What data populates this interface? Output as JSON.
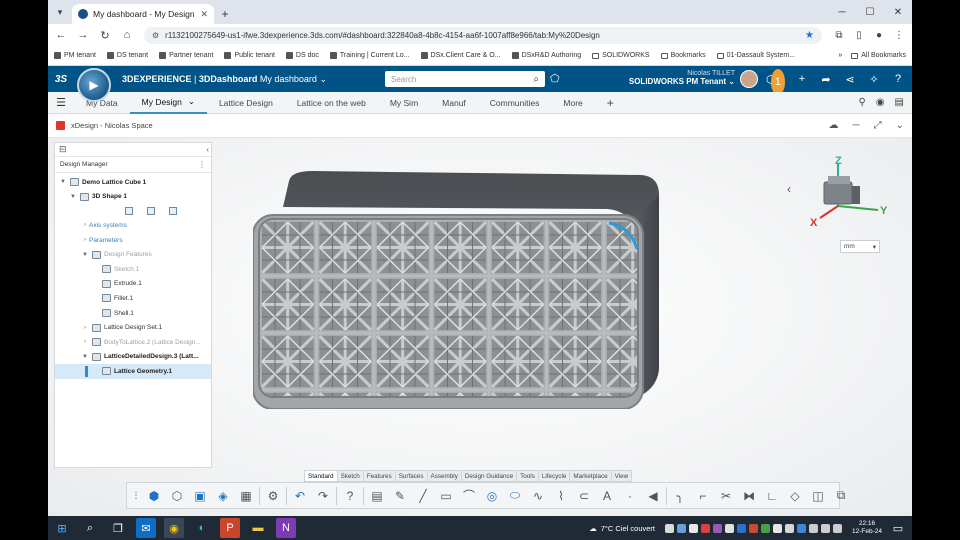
{
  "browser": {
    "tab_title": "My dashboard - My Design",
    "url": "r1132100275649-us1-ifwe.3dexperience.3ds.com/#dashboard:322840a8-4b8c-4154-aa6f-1007aff8e966/tab:My%20Design",
    "bookmarks": [
      "PM tenant",
      "DS tenant",
      "Partner tenant",
      "Public tenant",
      "DS doc",
      "Training | Current Lo...",
      "DSx.Client Care & O...",
      "DSxR&D Authoring",
      "SOLIDWORKS",
      "Bookmarks",
      "01-Dassault System..."
    ],
    "all_bookmarks": "All Bookmarks"
  },
  "header": {
    "brand_bold": "3DEXPERIENCE",
    "brand_app": "3DDashboard",
    "brand_dashboard": "My dashboard",
    "search_placeholder": "Search",
    "user_name": "Nicolas TILLET",
    "tenant": "SOLIDWORKS PM Tenant",
    "notification_count": "1"
  },
  "dashboard_tabs": [
    {
      "label": "My Data"
    },
    {
      "label": "My Design"
    },
    {
      "label": "Lattice Design"
    },
    {
      "label": "Lattice on the web"
    },
    {
      "label": "My Sim"
    },
    {
      "label": "Manuf"
    },
    {
      "label": "Communities"
    },
    {
      "label": "More"
    }
  ],
  "app": {
    "title": "xDesign - Nicolas Space"
  },
  "tree": {
    "title": "Design Manager",
    "nodes": [
      {
        "label": "Demo Lattice Cube 1"
      },
      {
        "label": "3D Shape 1"
      },
      {
        "label": "Axis systems"
      },
      {
        "label": "Parameters"
      },
      {
        "label": "Design Features"
      },
      {
        "label": "Sketch.1"
      },
      {
        "label": "Extrude.1"
      },
      {
        "label": "Fillet.1"
      },
      {
        "label": "Shell.1"
      },
      {
        "label": "Lattice Design Set.1"
      },
      {
        "label": "BodyToLattice.2 (Lattice Design..."
      },
      {
        "label": "LatticeDetailedDesign.3 (Latt..."
      },
      {
        "label": "Lattice Geometry.1"
      }
    ]
  },
  "viewport": {
    "unit": "mm",
    "axis_x": "X",
    "axis_y": "Y",
    "axis_z": "Z"
  },
  "action_bar": {
    "tabs": [
      "Standard",
      "Sketch",
      "Features",
      "Surfaces",
      "Assembly",
      "Design Guidance",
      "Tools",
      "Lifecycle",
      "Marketplace",
      "View"
    ]
  },
  "taskbar": {
    "weather": "7°C  Ciel couvert",
    "time": "22:16",
    "date": "12-Feb-24"
  }
}
